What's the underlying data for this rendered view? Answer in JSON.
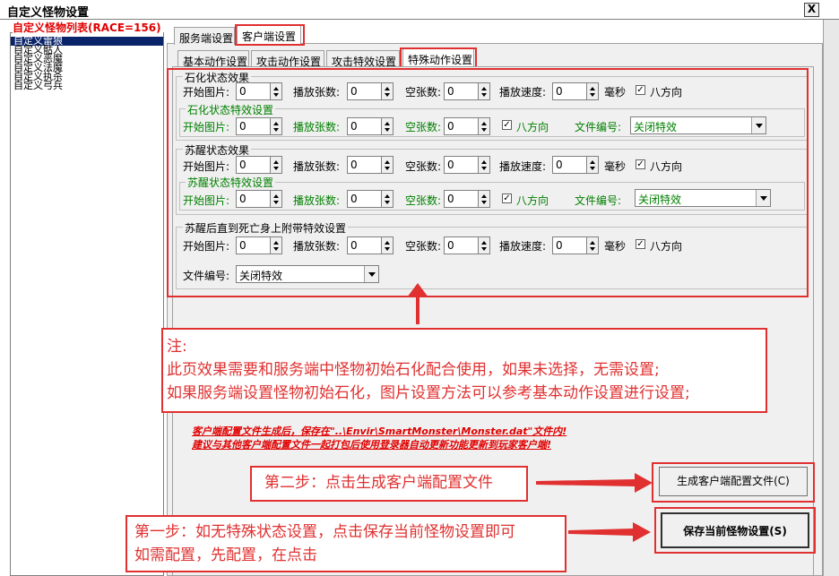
{
  "window": {
    "title": "自定义怪物设置",
    "close_label": "X"
  },
  "monster_list": {
    "header": "自定义怪物列表(RACE=156)",
    "items": [
      "自定义雷狼",
      "自定义骷人",
      "自定义恶魔",
      "自定义法魔",
      "自定义执杀",
      "自定义弓兵"
    ]
  },
  "tabs_outer": [
    "服务端设置",
    "客户端设置"
  ],
  "tabs_inner": [
    "基本动作设置",
    "攻击动作设置",
    "攻击特效设置",
    "特殊动作设置"
  ],
  "labels": {
    "start_image": "开始图片:",
    "play_count": "播放张数:",
    "empty_count": "空张数:",
    "play_speed": "播放速度:",
    "ms": "毫秒",
    "eight_dir": "八方向",
    "file_no": "文件编号:"
  },
  "groups": {
    "petrify": {
      "title": "石化状态效果",
      "effect_title": "石化状态特效设置",
      "start": "0",
      "count": "0",
      "empty": "0",
      "speed": "0",
      "eff_start": "0",
      "eff_count": "0",
      "eff_empty": "0",
      "eff_file": "关闭特效"
    },
    "revive": {
      "title": "苏醒状态效果",
      "effect_title": "苏醒状态特效设置",
      "start": "0",
      "count": "0",
      "empty": "0",
      "speed": "0",
      "eff_start": "0",
      "eff_count": "0",
      "eff_empty": "0",
      "eff_file": "关闭特效"
    },
    "death": {
      "title": "苏醒后直到死亡身上附带特效设置",
      "start": "0",
      "count": "0",
      "empty": "0",
      "speed": "0",
      "file": "关闭特效"
    }
  },
  "note": {
    "line1": "注:",
    "line2": "此页效果需要和服务端中怪物初始石化配合使用，如果未选择，无需设置;",
    "line3": "如果服务端设置怪物初始石化，图片设置方法可以参考基本动作设置进行设置;"
  },
  "info": {
    "line1": "客户端配置文件生成后，保存在\"..\\Envir\\SmartMonster\\Monster.dat\"文件内!",
    "line2": "建议与其他客户端配置文件一起打包后使用登录器自动更新功能更新到玩家客户端!"
  },
  "step2": "第二步：点击生成客户端配置文件",
  "step1": {
    "line1": "第一步：如无特殊状态设置，点击保存当前怪物设置即可",
    "line2": "如需配置，先配置，在点击"
  },
  "buttons": {
    "generate": "生成客户端配置文件(C)",
    "save": "保存当前怪物设置(S)"
  },
  "colors": {
    "annotation_red": "#e03030",
    "green_label": "#008000",
    "selection": "#0a246a"
  }
}
